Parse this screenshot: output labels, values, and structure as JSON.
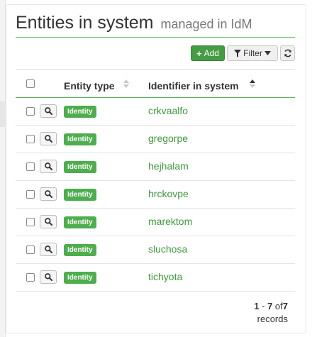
{
  "panel": {
    "title": "Entities in system",
    "subtitle": "managed in IdM"
  },
  "toolbar": {
    "add_label": "Add",
    "filter_label": "Filter"
  },
  "table": {
    "columns": {
      "entity_type": "Entity type",
      "identifier": "Identifier in system"
    },
    "sort": {
      "column": "identifier",
      "direction": "asc"
    },
    "rows": [
      {
        "entity_type": "Identity",
        "identifier": "crkvaalfo"
      },
      {
        "entity_type": "Identity",
        "identifier": "gregorpe"
      },
      {
        "entity_type": "Identity",
        "identifier": "hejhalam"
      },
      {
        "entity_type": "Identity",
        "identifier": "hrckovpe"
      },
      {
        "entity_type": "Identity",
        "identifier": "marektom"
      },
      {
        "entity_type": "Identity",
        "identifier": "sluchosa"
      },
      {
        "entity_type": "Identity",
        "identifier": "tichyota"
      }
    ]
  },
  "pagination": {
    "from": "1",
    "dash": "-",
    "to": "7",
    "of": "of",
    "total": "7",
    "unit": "records"
  },
  "colors": {
    "accent": "#5cb85c",
    "link": "#3c9a3c",
    "badge": "#4cae4c"
  }
}
